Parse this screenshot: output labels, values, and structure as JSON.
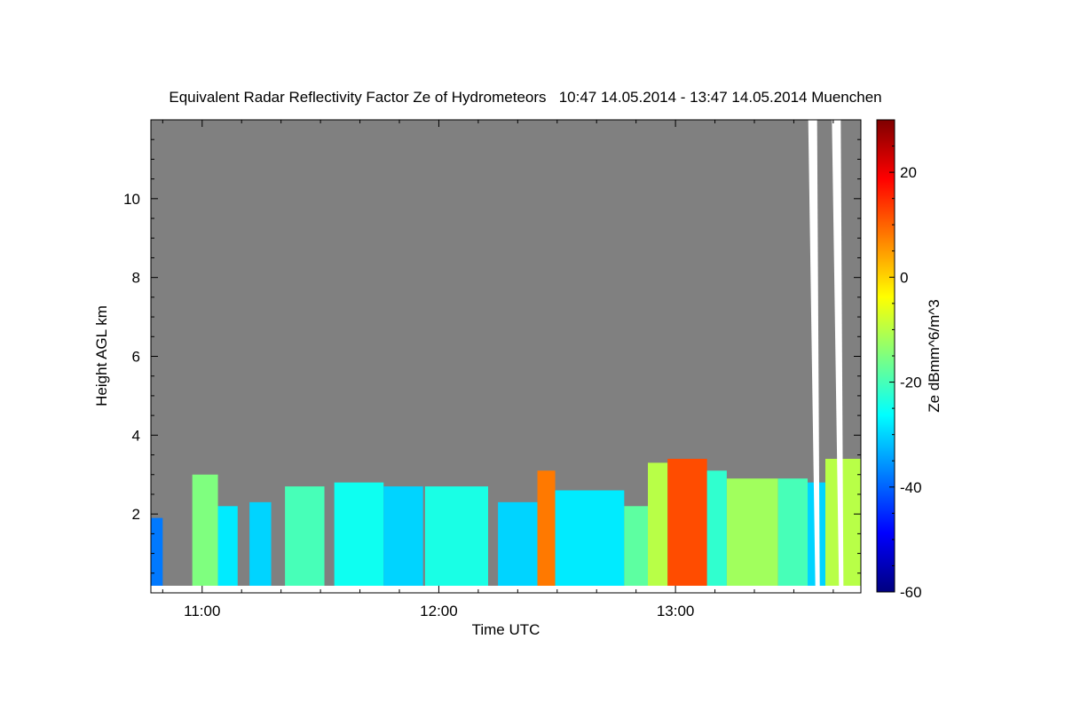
{
  "chart_data": {
    "type": "heatmap",
    "title": "Equivalent Radar Reflectivity Factor Ze of Hydrometeors   10:47 14.05.2014 - 13:47 14.05.2014 Muenchen",
    "xlabel": "Time UTC",
    "ylabel": "Height AGL km",
    "colorbar_label": "Ze dBmm^6/m^3",
    "x_unit": "minutes_utc",
    "xlim": [
      647.0,
      827.0
    ],
    "ylim": [
      0,
      12
    ],
    "clim": [
      -60,
      30
    ],
    "x_ticks": [
      {
        "value": 660,
        "label": "11:00"
      },
      {
        "value": 720,
        "label": "12:00"
      },
      {
        "value": 780,
        "label": "13:00"
      }
    ],
    "y_ticks": [
      2,
      4,
      6,
      8,
      10
    ],
    "colorbar_ticks": [
      20,
      0,
      -20,
      -40,
      -60
    ],
    "no_data_color": "#808080",
    "colormap": [
      "#00007f",
      "#0000ff",
      "#007fff",
      "#00ffff",
      "#7fff7f",
      "#ffff00",
      "#ff7f00",
      "#ff0000",
      "#7f0000"
    ],
    "grid": false,
    "echo_regions": [
      {
        "start": 647.0,
        "end": 650.0,
        "top": 1.9,
        "dbz": -38
      },
      {
        "start": 657.5,
        "end": 664.0,
        "top": 3.0,
        "dbz": -15
      },
      {
        "start": 664.0,
        "end": 669.0,
        "top": 2.2,
        "dbz": -28
      },
      {
        "start": 672.0,
        "end": 677.5,
        "top": 2.3,
        "dbz": -30
      },
      {
        "start": 681.0,
        "end": 691.0,
        "top": 2.7,
        "dbz": -20
      },
      {
        "start": 693.5,
        "end": 706.0,
        "top": 2.8,
        "dbz": -25
      },
      {
        "start": 706.0,
        "end": 716.0,
        "top": 2.7,
        "dbz": -30
      },
      {
        "start": 716.5,
        "end": 732.5,
        "top": 2.7,
        "dbz": -24
      },
      {
        "start": 735.0,
        "end": 745.0,
        "top": 2.3,
        "dbz": -30
      },
      {
        "start": 745.0,
        "end": 749.5,
        "top": 3.1,
        "dbz": 8
      },
      {
        "start": 749.5,
        "end": 767.0,
        "top": 2.6,
        "dbz": -28
      },
      {
        "start": 767.0,
        "end": 773.0,
        "top": 2.2,
        "dbz": -18
      },
      {
        "start": 773.0,
        "end": 778.0,
        "top": 3.3,
        "dbz": -10
      },
      {
        "start": 778.0,
        "end": 788.0,
        "top": 3.4,
        "dbz": 12
      },
      {
        "start": 788.0,
        "end": 793.0,
        "top": 3.1,
        "dbz": -22
      },
      {
        "start": 793.0,
        "end": 806.0,
        "top": 2.9,
        "dbz": -12
      },
      {
        "start": 806.0,
        "end": 813.5,
        "top": 2.9,
        "dbz": -20
      },
      {
        "start": 813.5,
        "end": 818.0,
        "top": 2.8,
        "dbz": -30
      },
      {
        "start": 818.0,
        "end": 827.0,
        "top": 3.4,
        "dbz": -10
      }
    ],
    "missing_data_strips": [
      {
        "time": 815.0,
        "height": 12,
        "label": ""
      },
      {
        "time": 821.0,
        "height": 12,
        "label": ""
      }
    ]
  }
}
